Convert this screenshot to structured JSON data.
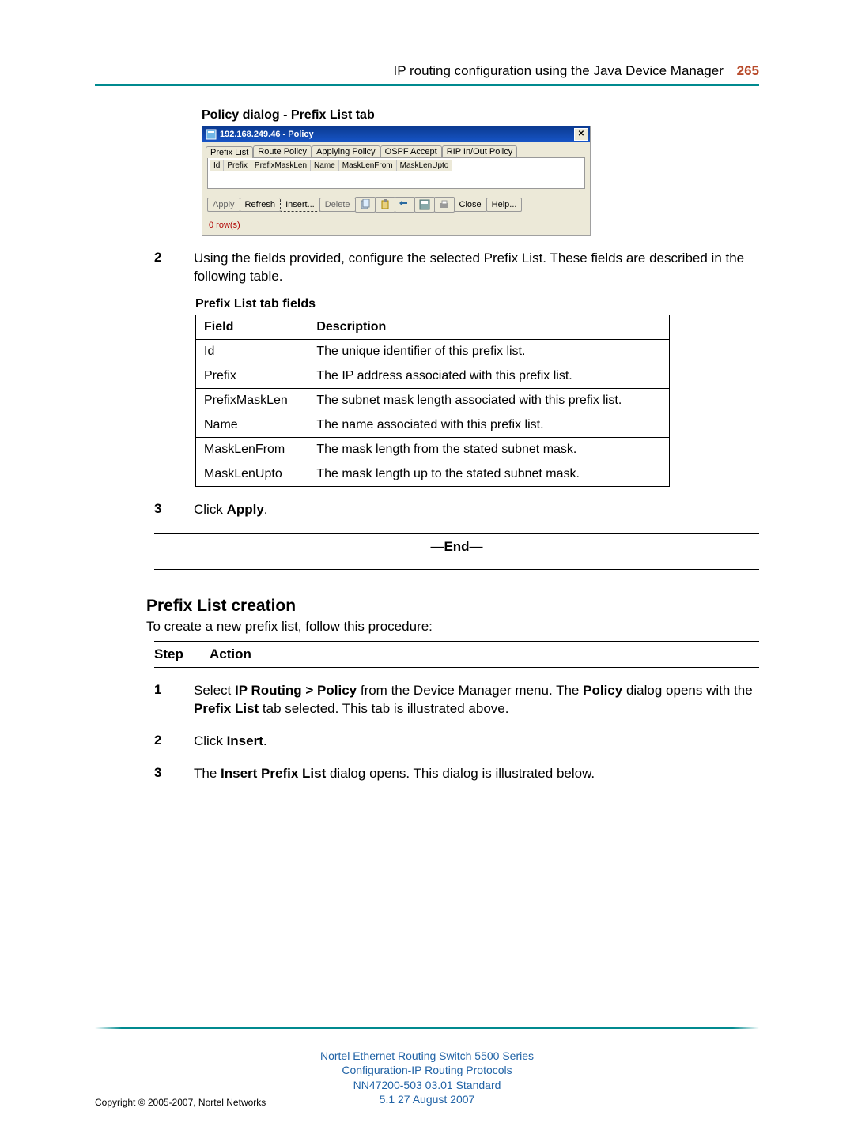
{
  "header": {
    "title": "IP routing configuration using the Java Device Manager",
    "page_number": "265"
  },
  "dialog_caption": "Policy dialog - Prefix List tab",
  "dialog": {
    "title": "192.168.249.46 - Policy",
    "tabs": [
      "Prefix List",
      "Route Policy",
      "Applying Policy",
      "OSPF Accept",
      "RIP In/Out Policy"
    ],
    "columns": [
      "Id",
      "Prefix",
      "PrefixMaskLen",
      "Name",
      "MaskLenFrom",
      "MaskLenUpto"
    ],
    "buttons": {
      "apply": "Apply",
      "refresh": "Refresh",
      "insert": "Insert...",
      "delete": "Delete",
      "close": "Close",
      "help": "Help..."
    },
    "row_count": "0 row(s)"
  },
  "step2": {
    "num": "2",
    "text": "Using the fields provided, configure the selected Prefix List. These fields are described in the following table."
  },
  "fields_caption": "Prefix List tab fields",
  "fields_table": {
    "headers": [
      "Field",
      "Description"
    ],
    "rows": [
      [
        "Id",
        "The unique identifier of this prefix list."
      ],
      [
        "Prefix",
        "The IP address associated with this prefix list."
      ],
      [
        "PrefixMaskLen",
        "The subnet mask length associated with this prefix list."
      ],
      [
        "Name",
        "The name associated with this prefix list."
      ],
      [
        "MaskLenFrom",
        "The mask length from the stated subnet mask."
      ],
      [
        "MaskLenUpto",
        "The mask length up to the stated subnet mask."
      ]
    ]
  },
  "step3": {
    "num": "3",
    "prefix": "Click ",
    "bold": "Apply",
    "suffix": "."
  },
  "end_label": "—End—",
  "section2": {
    "title": "Prefix List creation",
    "lead": "To create a new prefix list, follow this procedure:",
    "step_label": "Step",
    "action_label": "Action",
    "steps": [
      {
        "num": "1",
        "parts": [
          "Select ",
          {
            "b": "IP Routing > Policy"
          },
          " from the Device Manager menu. The ",
          {
            "b": "Policy"
          },
          " dialog opens with the ",
          {
            "b": "Prefix List"
          },
          " tab selected. This tab is illustrated above."
        ]
      },
      {
        "num": "2",
        "parts": [
          "Click ",
          {
            "b": "Insert"
          },
          "."
        ]
      },
      {
        "num": "3",
        "parts": [
          "The ",
          {
            "b": "Insert Prefix List"
          },
          " dialog opens. This dialog is illustrated below."
        ]
      }
    ]
  },
  "footer": {
    "lines": [
      "Nortel Ethernet Routing Switch 5500 Series",
      "Configuration-IP Routing Protocols",
      "NN47200-503   03.01   Standard",
      "5.1   27 August 2007"
    ],
    "copyright": "Copyright © 2005-2007, Nortel Networks"
  }
}
